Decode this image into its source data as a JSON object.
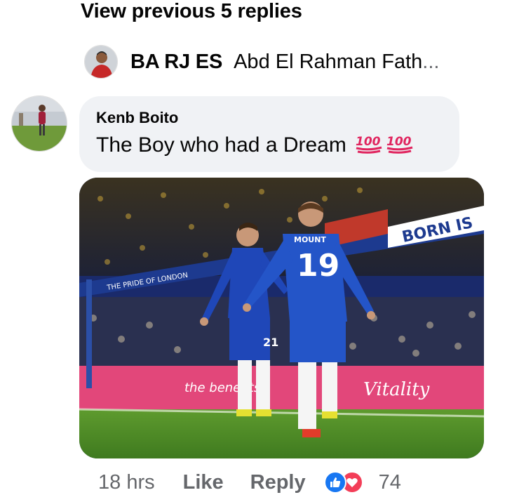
{
  "thread": {
    "view_previous_label": "View previous 5 replies"
  },
  "last_reply": {
    "author": "BA RJ ES",
    "text": "Abd El Rahman Fath",
    "ellipsis": "..."
  },
  "comment": {
    "author": "Kenb Boito",
    "text": "The Boy who had a Dream",
    "emoji_names": [
      "hundred-points-icon",
      "hundred-points-icon"
    ],
    "photo": {
      "description_icon": "football-celebration-photo",
      "sign_text": "BORN IS",
      "banner_text": "THE PRIDE OF LONDON",
      "ad_text": "Vitality",
      "ad_text_2": "the benefits",
      "jersey_number_back": "19",
      "jersey_name_back": "MOUNT",
      "jersey_number_front": "21"
    }
  },
  "actions": {
    "timestamp": "18 hrs",
    "like_label": "Like",
    "reply_label": "Reply",
    "reaction_count": "74"
  },
  "colors": {
    "bubble_bg": "#f0f2f5",
    "secondary_text": "#65676b",
    "like_blue": "#1877f2",
    "love_red": "#f33e58"
  }
}
